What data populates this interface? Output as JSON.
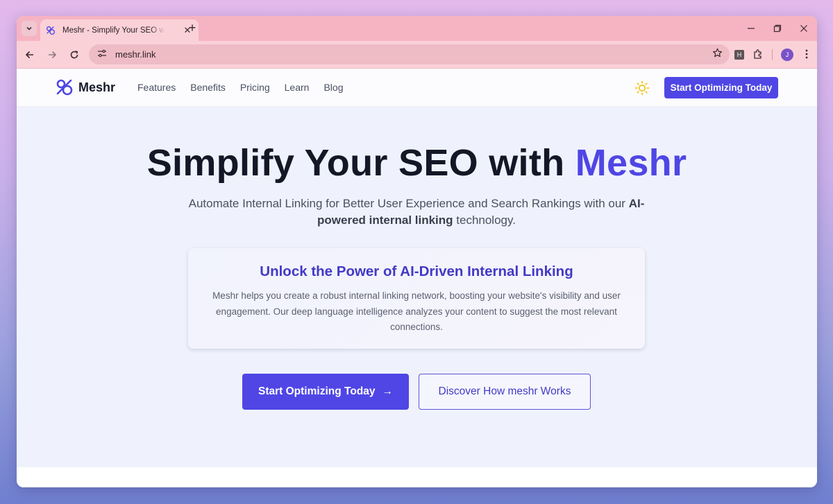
{
  "browser": {
    "tab_title": "Meshr - Simplify Your SEO with Meshr",
    "tab_close": "✕",
    "new_tab": "+",
    "url": "meshr.link",
    "profile_initial": "J",
    "extension_label": "H"
  },
  "site": {
    "brand": "Meshr",
    "nav": [
      {
        "label": "Features"
      },
      {
        "label": "Benefits"
      },
      {
        "label": "Pricing"
      },
      {
        "label": "Learn"
      },
      {
        "label": "Blog"
      }
    ],
    "nav_cta": "Start Optimizing Today",
    "colors": {
      "accent": "#4f46e5",
      "hero_bg": "#eff2fc",
      "sun": "#f5c518"
    }
  },
  "hero": {
    "title_prefix": "Simplify Your SEO with ",
    "title_accent": "Meshr",
    "sub_part1": "Automate Internal Linking for Better User Experience and Search Rankings with our ",
    "sub_bold": "AI-powered internal linking",
    "sub_part2": " technology.",
    "card_title": "Unlock the Power of AI-Driven Internal Linking",
    "card_body": "Meshr helps you create a robust internal linking network, boosting your website's visibility and user engagement. Our deep language intelligence analyzes your content to suggest the most relevant connections.",
    "primary_button": "Start Optimizing Today",
    "primary_arrow": "→",
    "secondary_button": "Discover How meshr Works"
  }
}
